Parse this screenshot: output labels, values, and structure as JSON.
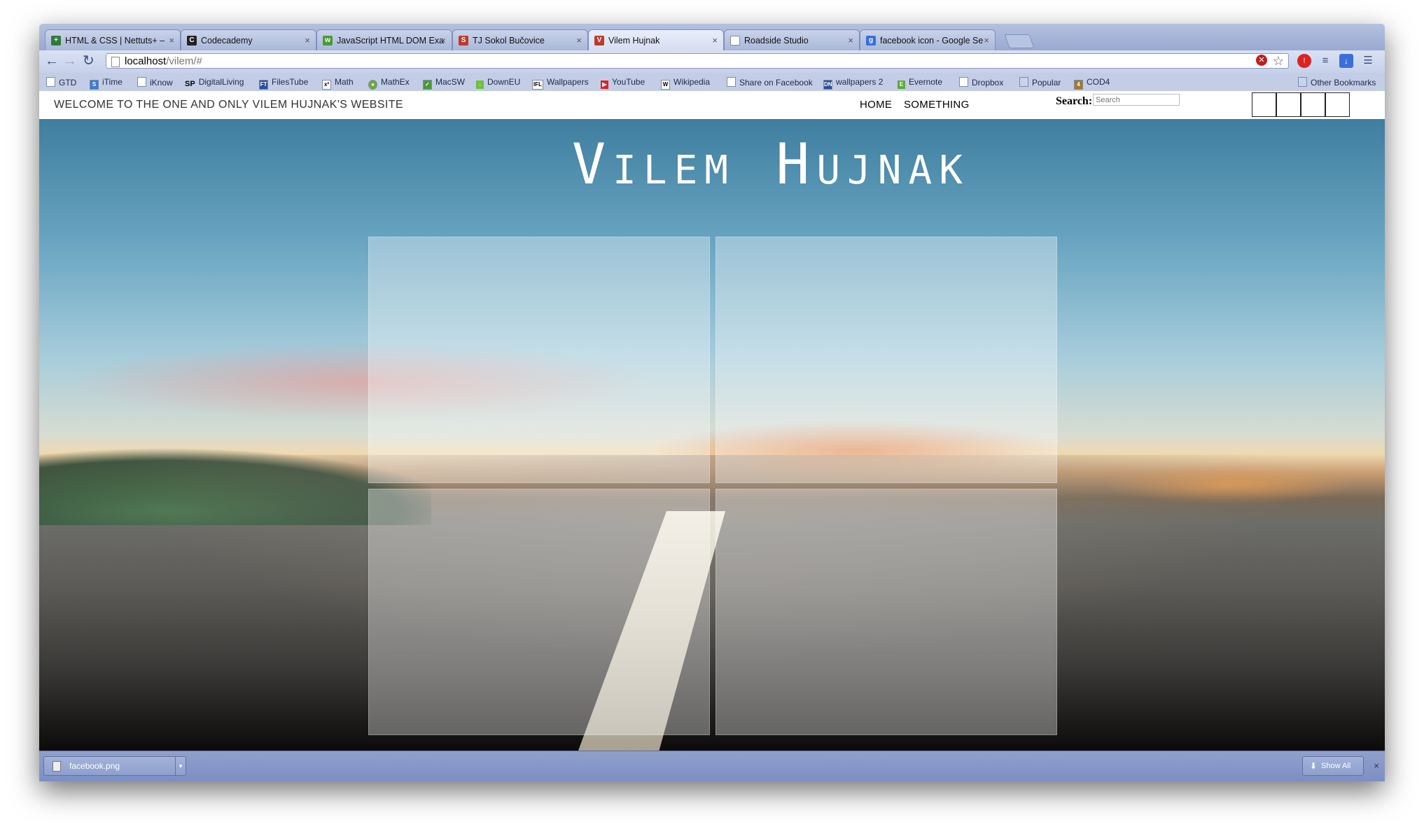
{
  "browser": {
    "tabs": [
      {
        "title": "HTML & CSS | Nettuts+ – ",
        "favicon_color": "#2f7a3a",
        "favicon_glyph": "+"
      },
      {
        "title": "Codecademy",
        "favicon_color": "#222222",
        "favicon_glyph": "C"
      },
      {
        "title": "JavaScript HTML DOM Exa",
        "favicon_color": "#4a9a3a",
        "favicon_glyph": "w"
      },
      {
        "title": "TJ Sokol Bučovice",
        "favicon_color": "#c0392b",
        "favicon_glyph": "S"
      },
      {
        "title": "Vilem Hujnak",
        "favicon_color": "#c0392b",
        "favicon_glyph": "V"
      },
      {
        "title": "Roadside Studio",
        "favicon_color": "#ffffff",
        "favicon_glyph": ""
      },
      {
        "title": "facebook icon - Google Se",
        "favicon_color": "#3b6fd8",
        "favicon_glyph": "g"
      }
    ],
    "close_glyph": "×",
    "url_host": "localhost",
    "url_path": "/vilem/#",
    "bookmarks": [
      {
        "label": "GTD",
        "icon": ""
      },
      {
        "label": "iTime",
        "icon": "S"
      },
      {
        "label": "iKnow",
        "icon": ""
      },
      {
        "label": "DigitalLiving",
        "icon": "SP"
      },
      {
        "label": "FilesTube",
        "icon": "FT"
      },
      {
        "label": "Math",
        "icon": "x²"
      },
      {
        "label": "MathEx",
        "icon": "●"
      },
      {
        "label": "MacSW",
        "icon": "✓"
      },
      {
        "label": "DownEU",
        "icon": "↓"
      },
      {
        "label": "Wallpapers",
        "icon": "IFL"
      },
      {
        "label": "YouTube",
        "icon": "▶"
      },
      {
        "label": "Wikipedia",
        "icon": "W"
      },
      {
        "label": "Share on Facebook",
        "icon": ""
      },
      {
        "label": "wallpapers 2",
        "icon": "DN"
      },
      {
        "label": "Evernote",
        "icon": "E"
      },
      {
        "label": "Dropbox",
        "icon": ""
      },
      {
        "label": "Popular",
        "icon": "▭"
      },
      {
        "label": "COD4",
        "icon": "4"
      }
    ],
    "other_bookmarks": "Other Bookmarks"
  },
  "site": {
    "welcome": "WELCOME TO THE ONE AND ONLY VILEM HUJNAK'S WEBSITE",
    "nav": [
      "HOME",
      "SOMETHING"
    ],
    "search_label": "Search:",
    "search_placeholder": "Search",
    "title": "Vilem Hujnak"
  },
  "downloads": {
    "file": "facebook.png",
    "show_all": "Show All",
    "close": "×"
  }
}
